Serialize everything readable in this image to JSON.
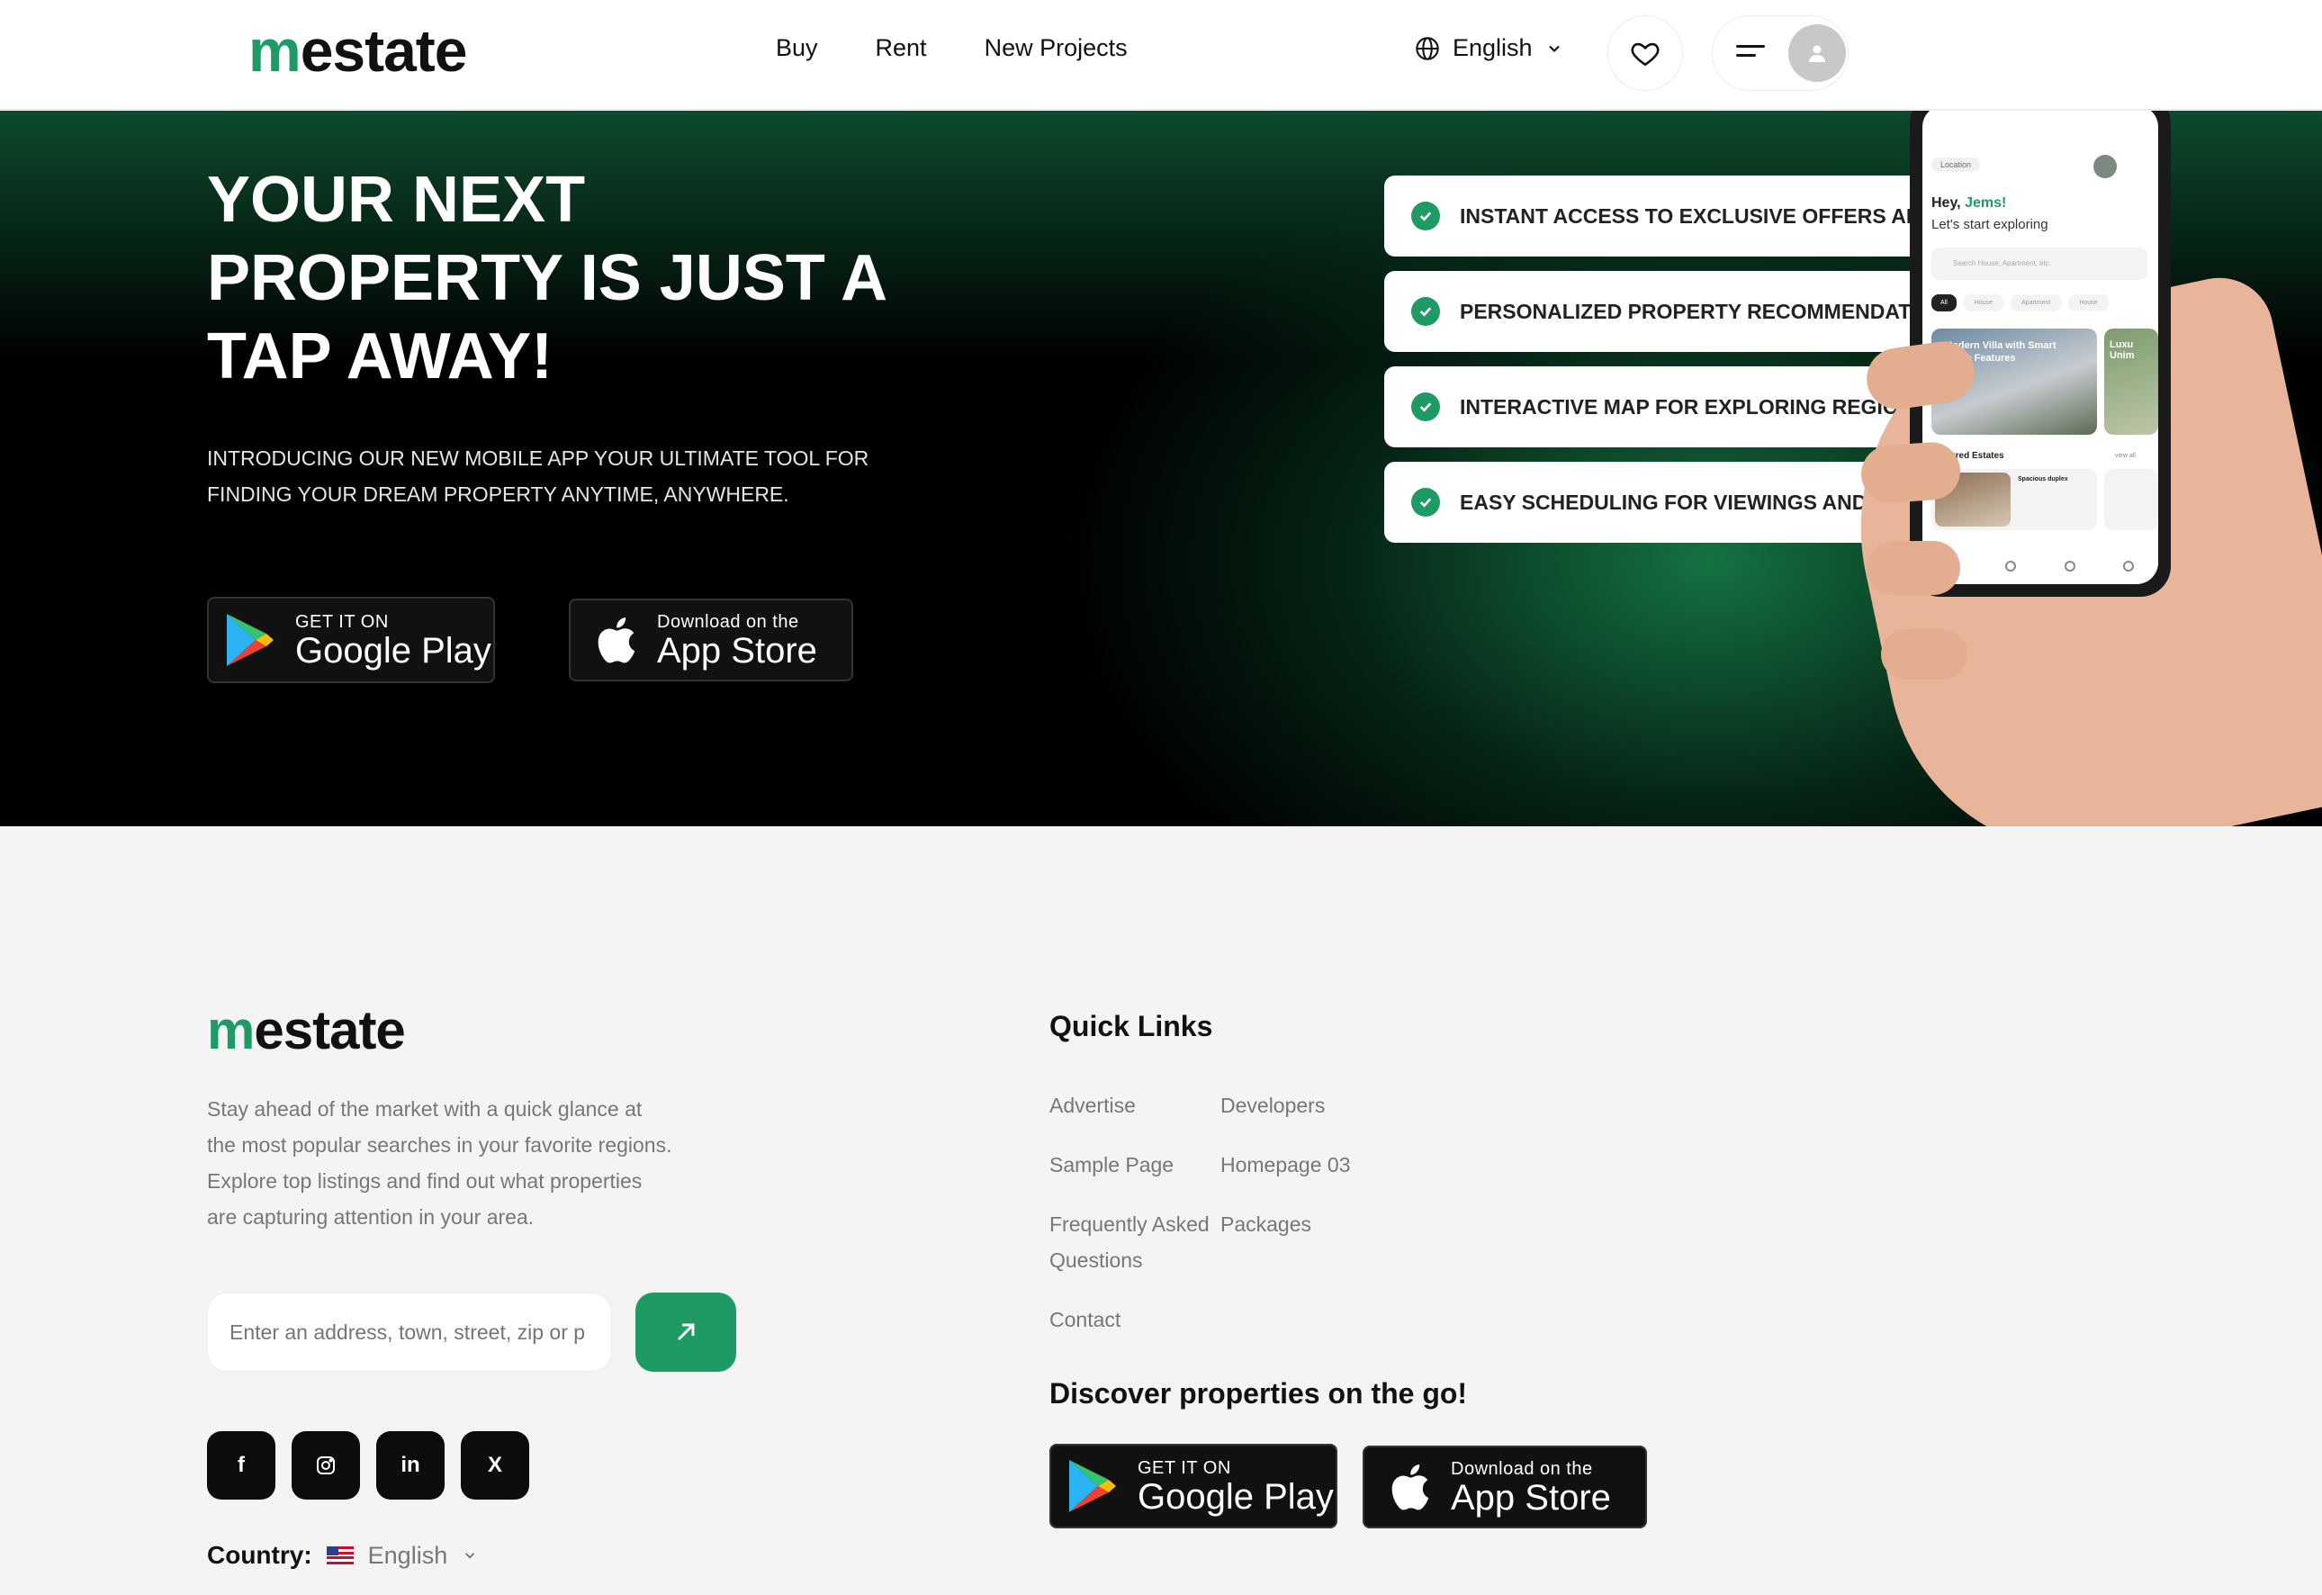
{
  "header": {
    "logo": "mestate",
    "nav": [
      "Buy",
      "Rent",
      "New Projects"
    ],
    "language": "English"
  },
  "hero": {
    "title": "YOUR NEXT PROPERTY IS JUST A TAP AWAY!",
    "subtitle": "INTRODUCING OUR NEW MOBILE APP YOUR ULTIMATE TOOL FOR FINDING YOUR DREAM PROPERTY ANYTIME, ANYWHERE.",
    "features": [
      "INSTANT ACCESS TO EXCLUSIVE OFFERS AND",
      "PERSONALIZED PROPERTY RECOMMENDAT",
      "INTERACTIVE MAP FOR EXPLORING REGIO",
      "EASY SCHEDULING FOR VIEWINGS AND INQ"
    ],
    "phone": {
      "location_chip": "Location",
      "greeting": "Hey,",
      "user": "Jems!",
      "prompt": "Let's start exploring",
      "search_placeholder": "Search House, Apartment, etc.",
      "filters": [
        "All",
        "House",
        "Apartment",
        "House"
      ],
      "card_title": "Modern Villa with Smart Home Features",
      "side_card": "Luxu Unim",
      "featured_label": "Featured Estates",
      "view_all": "view all",
      "featured_item": "Spacious duplex"
    }
  },
  "stores": {
    "google_small": "GET IT ON",
    "google_big": "Google Play",
    "apple_small": "Download on the",
    "apple_big": "App Store"
  },
  "footer": {
    "logo": "mestate",
    "description": "Stay ahead of the market with a quick glance at the most popular searches in your favorite regions. Explore top listings and find out what properties are capturing attention in your area.",
    "search_placeholder": "Enter an address, town, street, zip or p",
    "socials": [
      "f",
      "ig",
      "in",
      "X"
    ],
    "country_label": "Country:",
    "country_value": "English",
    "quick_links_title": "Quick Links",
    "links": {
      "advertise": "Advertise",
      "developers": "Developers",
      "sample_page": "Sample Page",
      "homepage03": "Homepage 03",
      "faq_line1": "Frequently Asked",
      "faq_line2": "Questions",
      "packages": "Packages",
      "contact": "Contact"
    },
    "discover_title": "Discover properties on the go!"
  },
  "colors": {
    "accent": "#1e9b64",
    "dark": "#0c0c0c",
    "footer_bg": "#f4f4f4"
  }
}
